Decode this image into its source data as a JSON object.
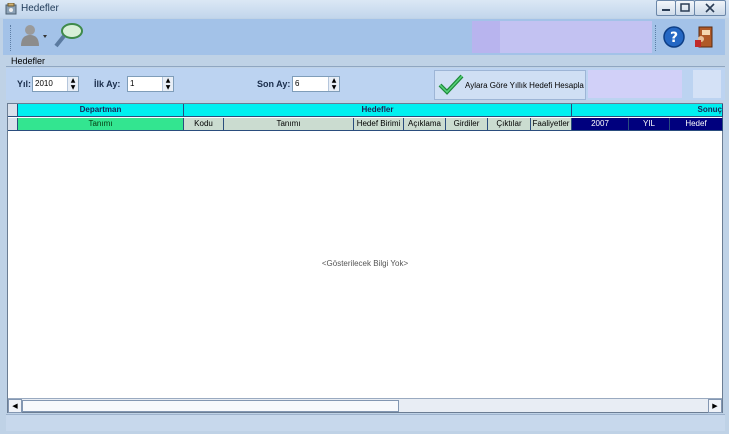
{
  "window": {
    "title": "Hedefler"
  },
  "toolbar": {
    "tool1": "person-icon",
    "tool2": "search-icon",
    "help": "help-icon",
    "exit": "exit-door-icon"
  },
  "panel": {
    "label": "Hedefler"
  },
  "filters": {
    "year_label": "Yıl:",
    "year_value": "2010",
    "start_month_label": "İlk Ay:",
    "start_month_value": "1",
    "end_month_label": "Son Ay:",
    "end_month_value": "6",
    "calc_button_label": "Aylara Göre Yıllık Hedefi Hesapla"
  },
  "grid": {
    "band_headers": {
      "department": "Departman",
      "targets": "Hedefler",
      "results": "Sonuç"
    },
    "columns": {
      "dept_name": "Tanımı",
      "code": "Kodu",
      "name": "Tanımı",
      "unit": "Hedef Birimi",
      "description": "Açıklama",
      "inputs": "Girdiler",
      "outputs": "Çıktılar",
      "activities": "Faaliyetler",
      "year": "2007",
      "yil": "YIL",
      "target": "Hedef"
    },
    "empty_message": "<Gösterilecek Bilgi Yok>"
  },
  "colors": {
    "header_cyan": "#00f0f0",
    "dept_green": "#33e590",
    "navy": "#00007e"
  }
}
